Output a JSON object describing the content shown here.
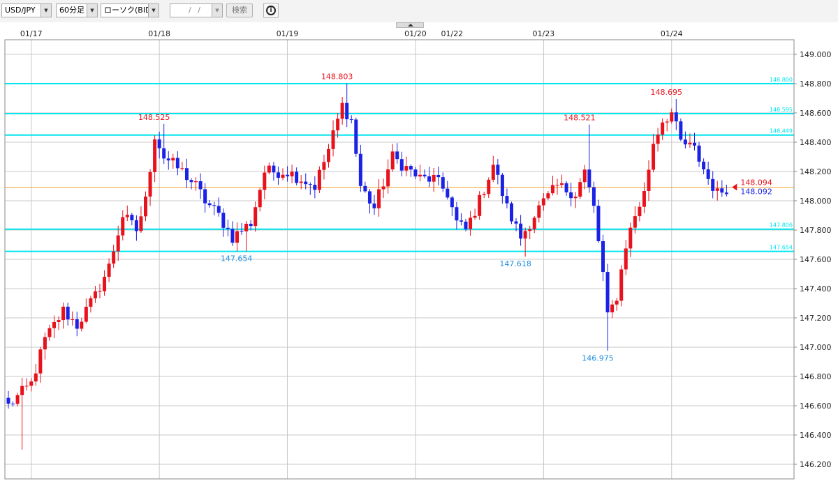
{
  "toolbar": {
    "symbol": "USD/JPY",
    "interval": "60分足",
    "chart_kind": "ローソク(BID)",
    "date_placeholder": "/ /",
    "search_label": "検索",
    "info_glyph": "i"
  },
  "colors": {
    "up": "#e8121c",
    "down": "#1a22e6",
    "level_line": "#00e5ee",
    "current_line": "#f0a030",
    "grid": "#c8c8c8",
    "high_label": "#e8121c",
    "low_label": "#1f8ee0"
  },
  "chart_data": {
    "type": "candlestick",
    "ylim": [
      146.1,
      149.1
    ],
    "y_ticks": [
      146.2,
      146.4,
      146.6,
      146.8,
      147.0,
      147.2,
      147.4,
      147.6,
      147.8,
      148.0,
      148.2,
      148.4,
      148.6,
      148.8,
      149.0
    ],
    "date_labels": [
      "01/17",
      "01/18",
      "01/19",
      "01/20",
      "01/22",
      "01/23",
      "01/24"
    ],
    "session_separators": [
      "01/17",
      "01/18",
      "01/19",
      "01/20",
      "01/23",
      "01/24"
    ],
    "levels": [
      {
        "value": 148.8,
        "label": "148.800"
      },
      {
        "value": 148.595,
        "label": "148.595"
      },
      {
        "value": 148.449,
        "label": "148.449"
      },
      {
        "value": 147.806,
        "label": "147.806"
      },
      {
        "value": 147.654,
        "label": "147.654"
      }
    ],
    "current_price": {
      "ask": "148.094",
      "bid": "148.092",
      "value": 148.093
    },
    "annotations": [
      {
        "text": "148.525",
        "kind": "high",
        "value": 148.525
      },
      {
        "text": "148.803",
        "kind": "high",
        "value": 148.803
      },
      {
        "text": "148.521",
        "kind": "high",
        "value": 148.521
      },
      {
        "text": "148.695",
        "kind": "high",
        "value": 148.695
      },
      {
        "text": "147.654",
        "kind": "low",
        "value": 147.654
      },
      {
        "text": "147.618",
        "kind": "low",
        "value": 147.618
      },
      {
        "text": "146.975",
        "kind": "low",
        "value": 146.975
      }
    ],
    "waypoints": [
      [
        0,
        146.6
      ],
      [
        5,
        146.75
      ],
      [
        8,
        147.05
      ],
      [
        12,
        147.25
      ],
      [
        15,
        147.15
      ],
      [
        19,
        147.35
      ],
      [
        22,
        147.55
      ],
      [
        25,
        147.9
      ],
      [
        28,
        147.8
      ],
      [
        30,
        148.0
      ],
      [
        32,
        148.45
      ],
      [
        34,
        148.3
      ],
      [
        38,
        148.2
      ],
      [
        41,
        148.1
      ],
      [
        43,
        148.0
      ],
      [
        46,
        147.9
      ],
      [
        49,
        147.75
      ],
      [
        53,
        147.85
      ],
      [
        56,
        148.2
      ],
      [
        61,
        148.2
      ],
      [
        64,
        148.15
      ],
      [
        67,
        148.1
      ],
      [
        70,
        148.35
      ],
      [
        73,
        148.65
      ],
      [
        75,
        148.55
      ],
      [
        77,
        148.1
      ],
      [
        80,
        147.95
      ],
      [
        84,
        148.3
      ],
      [
        90,
        148.15
      ],
      [
        93,
        148.15
      ],
      [
        96,
        148.05
      ],
      [
        98,
        147.85
      ],
      [
        100,
        147.8
      ],
      [
        103,
        148.0
      ],
      [
        106,
        148.25
      ],
      [
        109,
        147.95
      ],
      [
        112,
        147.75
      ],
      [
        116,
        147.95
      ],
      [
        120,
        148.1
      ],
      [
        124,
        148.05
      ],
      [
        126,
        148.2
      ],
      [
        128,
        147.95
      ],
      [
        130,
        147.5
      ],
      [
        131,
        147.2
      ],
      [
        133,
        147.35
      ],
      [
        135,
        147.7
      ],
      [
        137,
        147.9
      ],
      [
        139,
        148.05
      ],
      [
        141,
        148.4
      ],
      [
        143,
        148.55
      ],
      [
        145,
        148.6
      ],
      [
        147,
        148.4
      ],
      [
        150,
        148.35
      ],
      [
        153,
        148.15
      ],
      [
        155,
        148.05
      ],
      [
        157,
        148.09
      ]
    ]
  }
}
